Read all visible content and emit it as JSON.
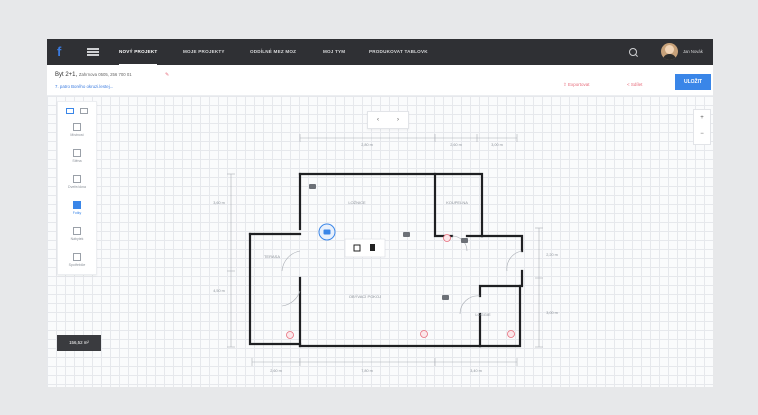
{
  "nav": {
    "items": [
      "NOVÝ PROJEKT",
      "MOJE PROJEKTY",
      "ODDÍLNÉ MEZ MOZ",
      "MOJ TYM",
      "PRODUKOVAT TABLOVK"
    ],
    "active_index": 0,
    "username": "Jan Novák"
  },
  "project": {
    "title": "Byt 2+1,",
    "subtitle": "Zahrnova 0505, 256 700 01",
    "link": "7. patro Borého okruzi.lestej..."
  },
  "actions": {
    "export": "Exportovat",
    "share": "Sdílet",
    "save": "ULOŽIT"
  },
  "tools": {
    "items": [
      {
        "label": "Místnost",
        "icon": "room-icon"
      },
      {
        "label": "Stěna",
        "icon": "pencil-icon"
      },
      {
        "label": "Dveře/okna",
        "icon": "door-icon"
      },
      {
        "label": "Fotky",
        "icon": "camera-icon"
      },
      {
        "label": "Nábytek",
        "icon": "furniture-icon"
      },
      {
        "label": "Spotřebiče",
        "icon": "appliance-icon"
      }
    ],
    "active_index": 3
  },
  "area": "156,52 m²",
  "pager": {
    "prev": "‹",
    "next": "›"
  },
  "zoom": {
    "in": "+",
    "out": "−"
  },
  "floorplan": {
    "rooms": [
      "LOŽNICE",
      "KOUPELNA",
      "TERASA",
      "OBÝVACÍ POKOJ",
      "LOGGIE"
    ],
    "dimensions": {
      "top": [
        "2,80 m",
        "2,60 m",
        "3,00 m"
      ],
      "left": [
        "3,60 m",
        "4,50 m"
      ],
      "right": [
        "2,20 m",
        "3,00 m"
      ],
      "bottom": [
        "2,60 m",
        "7,80 m",
        "3,40 m"
      ]
    }
  }
}
